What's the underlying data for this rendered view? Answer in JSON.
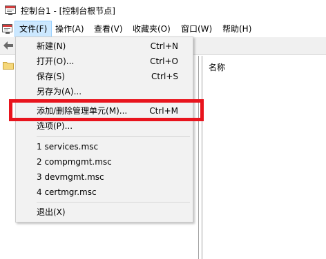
{
  "window": {
    "title": "控制台1 - [控制台根节点]",
    "icon": "console-app-icon"
  },
  "menubar": {
    "items": [
      {
        "label": "文件(F)",
        "active": true
      },
      {
        "label": "操作(A)"
      },
      {
        "label": "查看(V)"
      },
      {
        "label": "收藏夹(O)"
      },
      {
        "label": "窗口(W)"
      },
      {
        "label": "帮助(H)"
      }
    ]
  },
  "result_pane": {
    "column_header": "名称"
  },
  "file_menu": {
    "items": [
      {
        "label": "新建(N)",
        "shortcut": "Ctrl+N"
      },
      {
        "label": "打开(O)...",
        "shortcut": "Ctrl+O"
      },
      {
        "label": "保存(S)",
        "shortcut": "Ctrl+S"
      },
      {
        "label": "另存为(A)...",
        "shortcut": ""
      },
      {
        "label": "添加/删除管理单元(M)...",
        "shortcut": "Ctrl+M",
        "highlighted": true
      },
      {
        "label": "选项(P)...",
        "shortcut": ""
      },
      {
        "label": "1 services.msc",
        "shortcut": ""
      },
      {
        "label": "2 compmgmt.msc",
        "shortcut": ""
      },
      {
        "label": "3 devmgmt.msc",
        "shortcut": ""
      },
      {
        "label": "4 certmgr.msc",
        "shortcut": ""
      },
      {
        "label": "退出(X)",
        "shortcut": ""
      }
    ]
  },
  "colors": {
    "highlight_box": "#e8141d",
    "active_menu_bg": "#cce8ff",
    "menu_bg": "#f2f2f2"
  }
}
